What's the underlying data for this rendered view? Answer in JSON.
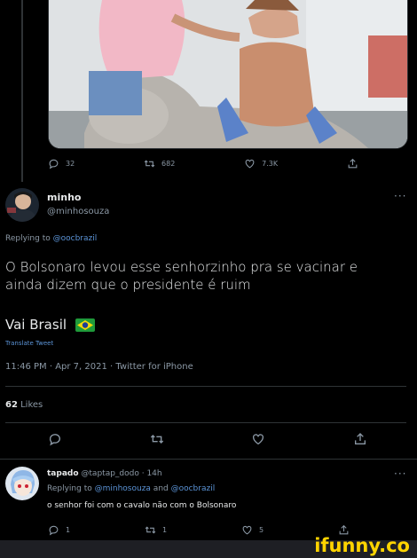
{
  "prev_tweet": {
    "image_alt": "A shirtless elderly man wearing a hat sits on a horse while a woman in a pink top gives him a vaccine",
    "replies": "32",
    "retweets": "682",
    "likes": "7.3K"
  },
  "tweet": {
    "display_name": "minho",
    "handle": "@minhosouza",
    "replying_prefix": "Replying to ",
    "replying_to": "@oocbrazil",
    "text_line1": "O Bolsonaro levou esse senhorzinho pra se vacinar e",
    "text_line2": "ainda dizem que o presidente é ruim",
    "text_line3": "Vai Brasil",
    "translate": "Translate Tweet",
    "timestamp": "11:46 PM · Apr 7, 2021 · Twitter for iPhone",
    "likes_count": "62",
    "likes_label": "Likes"
  },
  "reply": {
    "display_name": "tapado",
    "handle_time": "@taptap_dodo · 14h",
    "replying_prefix": "Replying to ",
    "replying_to_1": "@minhosouza",
    "replying_and": " and ",
    "replying_to_2": "@oocbrazil",
    "text": "o senhor foi com o cavalo não com o Bolsonaro",
    "replies": "1",
    "retweets": "1",
    "likes": "5"
  },
  "more_icon": "···",
  "watermark": "ifunny.co",
  "colors": {
    "background": "#000000",
    "link": "#5b93d6",
    "muted": "#8b98a5",
    "watermark": "#ffd400"
  }
}
